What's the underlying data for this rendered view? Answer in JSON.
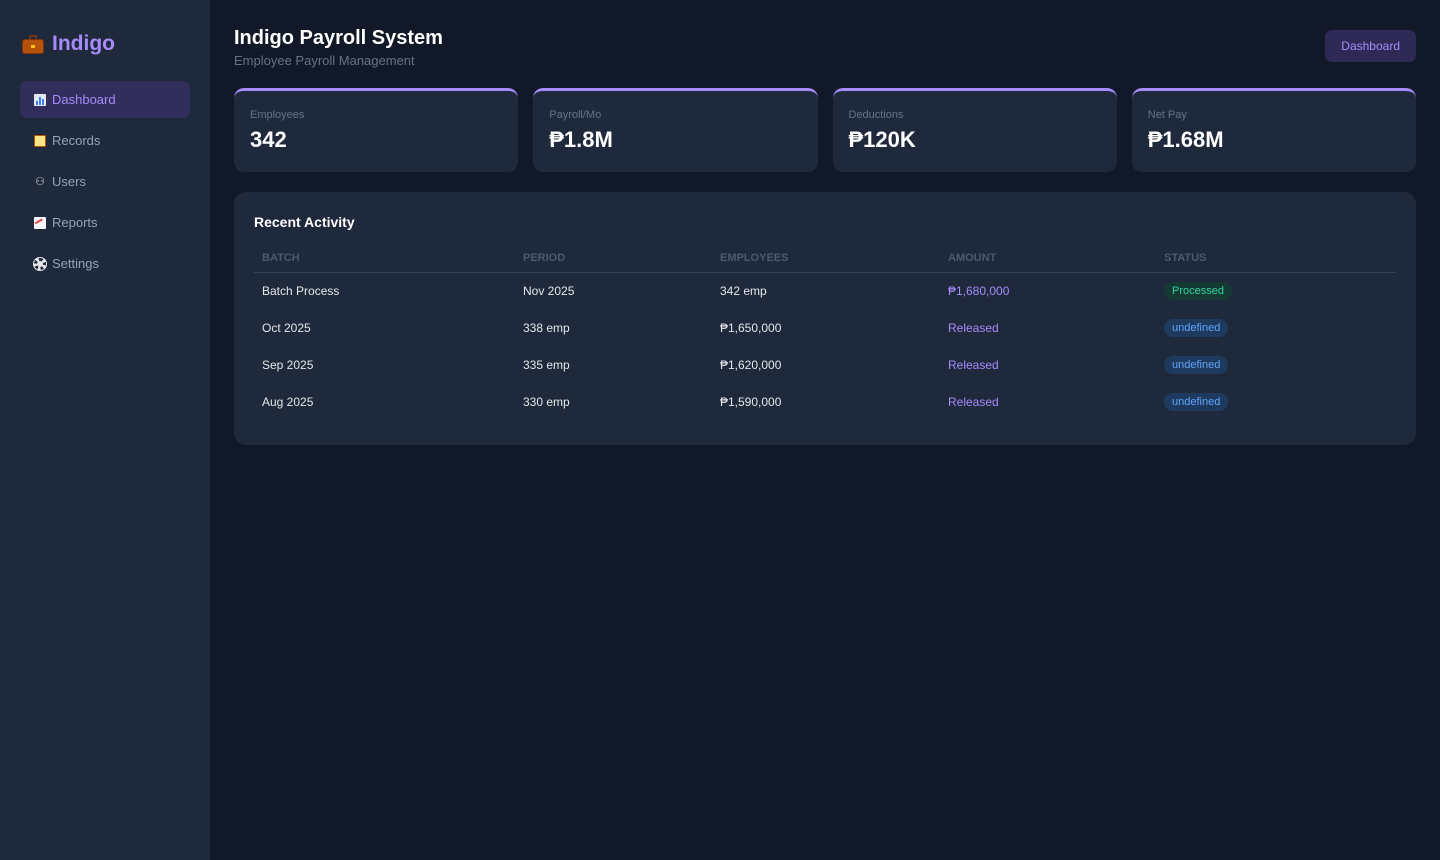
{
  "brand": {
    "name": "Indigo",
    "icon": "briefcase-icon"
  },
  "nav": [
    {
      "label": "Dashboard",
      "icon": "bar-chart-icon",
      "active": true
    },
    {
      "label": "Records",
      "icon": "clipboard-icon",
      "active": false
    },
    {
      "label": "Users",
      "icon": "users-icon",
      "active": false
    },
    {
      "label": "Reports",
      "icon": "trend-chart-icon",
      "active": false
    },
    {
      "label": "Settings",
      "icon": "gear-icon",
      "active": false
    }
  ],
  "header": {
    "title": "Indigo Payroll System",
    "subtitle": "Employee Payroll Management",
    "button_label": "Dashboard"
  },
  "stats": [
    {
      "label": "Employees",
      "value": "342"
    },
    {
      "label": "Payroll/Mo",
      "value": "₱1.8M"
    },
    {
      "label": "Deductions",
      "value": "₱120K"
    },
    {
      "label": "Net Pay",
      "value": "₱1.68M"
    }
  ],
  "activity": {
    "title": "Recent Activity",
    "columns": [
      "BATCH",
      "PERIOD",
      "EMPLOYEES",
      "AMOUNT",
      "STATUS"
    ],
    "rows": [
      [
        "Batch Process",
        "Nov 2025",
        "342 emp",
        "₱1,680,000",
        "Processed"
      ],
      [
        "Oct 2025",
        "338 emp",
        "₱1,650,000",
        "Released",
        "undefined"
      ],
      [
        "Sep 2025",
        "335 emp",
        "₱1,620,000",
        "Released",
        "undefined"
      ],
      [
        "Aug 2025",
        "330 emp",
        "₱1,590,000",
        "Released",
        "undefined"
      ]
    ]
  },
  "colors": {
    "accent": "#a78bfa",
    "background": "#111827",
    "panel": "#1e293b",
    "status_green": "#34d399",
    "status_blue": "#60a5fa"
  }
}
